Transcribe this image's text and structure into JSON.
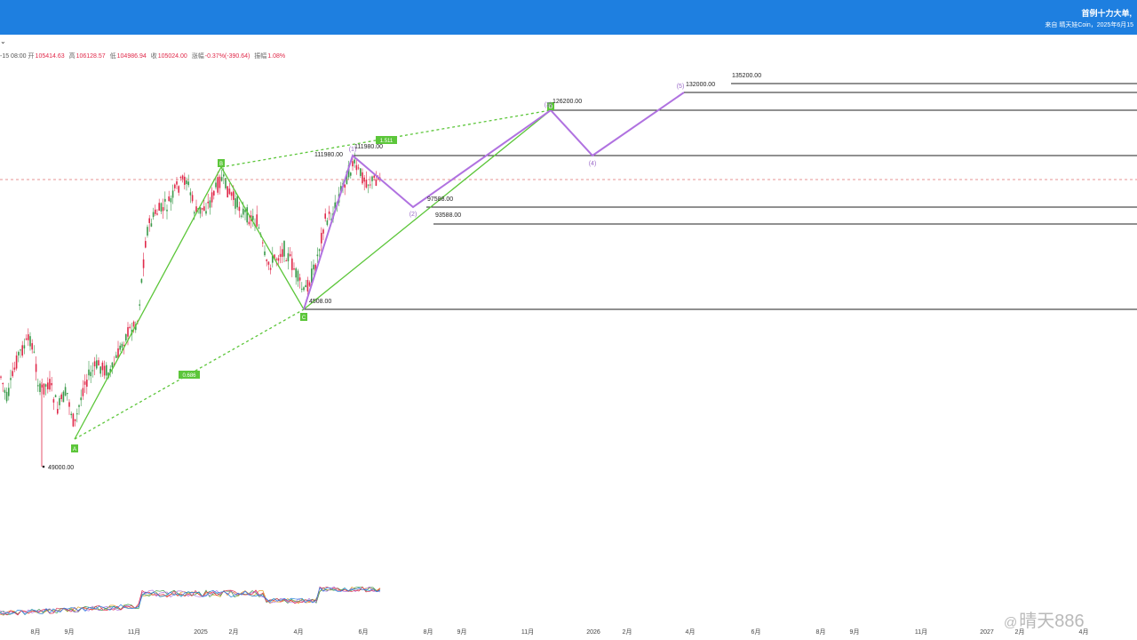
{
  "header": {
    "title": "首例十力大单,",
    "subtitle": "来自 晴天娃Coin，2025年6月15"
  },
  "toolbar": {
    "chevron": "⌄"
  },
  "ohlc": {
    "time": "-15 08:00",
    "open_label": "开",
    "open": "105414.63",
    "high_label": "高",
    "high": "106128.57",
    "low_label": "低",
    "low": "104986.94",
    "close_label": "收",
    "close": "105024.00",
    "change_label": "涨幅",
    "change": "-0.37%(-390.64)",
    "amplitude_label": "振幅",
    "amplitude": "1.08%"
  },
  "chart_data": {
    "type": "candlestick",
    "x_tick_labels": [
      "8月",
      "9月",
      "11月",
      "2025",
      "2月",
      "4月",
      "6月",
      "8月",
      "9月",
      "11月",
      "2026",
      "2月",
      "4月",
      "6月",
      "8月",
      "9月",
      "11月",
      "2027",
      "2月",
      "4月"
    ],
    "price_labels": {
      "low": "49000.00",
      "c_low": "4508.00",
      "b1": "111980.00",
      "b2": "111980.00",
      "d": "126200.00",
      "w5": "132000.00",
      "top": "135200.00",
      "s1": "97588.00",
      "s2": "93588.00"
    },
    "horizontal_levels": [
      135200,
      132000,
      126200,
      111980,
      97588,
      93588,
      74508
    ],
    "harmonic_points": {
      "A": "A",
      "B": "B",
      "C": "C",
      "D": "D"
    },
    "ratios": {
      "ac": "0.686",
      "bd": "1.511"
    },
    "wave_labels": [
      "(1)",
      "(2)",
      "(3)",
      "(4)",
      "(5)"
    ],
    "colors": {
      "harmonic": "#5cc63a",
      "wave": "#b072e0",
      "up": "#3a9a4a",
      "down": "#e0294a",
      "level": "#222222",
      "current": "#e07070"
    }
  },
  "watermark": {
    "at": "@",
    "text": "晴天886"
  }
}
